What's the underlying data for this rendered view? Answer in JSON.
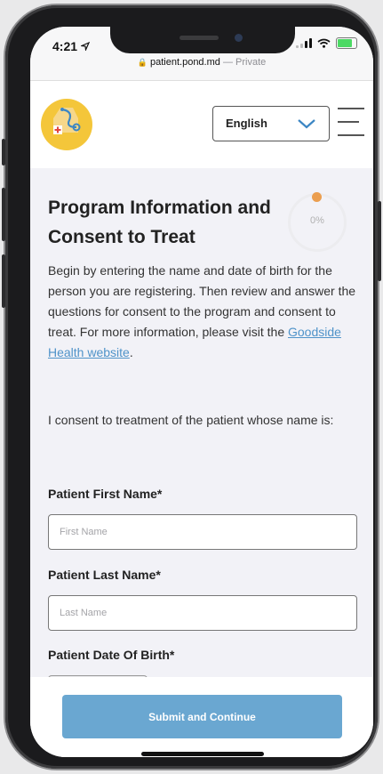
{
  "status": {
    "time": "4:21"
  },
  "browser": {
    "domain": "patient.pond.md",
    "separator": "—",
    "mode": "Private"
  },
  "header": {
    "language": "English"
  },
  "page": {
    "title": "Program Information and Consent to Treat",
    "progress": "0%",
    "intro": {
      "text": "Begin by entering the name and date of birth for the person you are registering. Then review and answer the questions for consent to the program and consent to treat. For more information, please visit the ",
      "link": "Goodside Health website",
      "end": "."
    },
    "consent": "I consent to treatment of the patient whose name is:",
    "fields": {
      "first_name": {
        "label": "Patient First Name*",
        "placeholder": "First Name"
      },
      "last_name": {
        "label": "Patient Last Name*",
        "placeholder": "Last Name"
      },
      "dob": {
        "label": "Patient Date Of Birth*"
      }
    },
    "submit": "Submit and Continue"
  },
  "colors": {
    "accent": "#6aa7d1",
    "link": "#4f93c9",
    "progress_dot": "#eb9e4f",
    "logo": "#f4c63a",
    "battery": "#4cd964"
  },
  "icons": [
    "location-arrow-icon",
    "signal-icon",
    "wifi-icon",
    "battery-charging-icon",
    "lock-icon",
    "chevron-down-icon",
    "hamburger-menu-icon",
    "logo-icon"
  ]
}
